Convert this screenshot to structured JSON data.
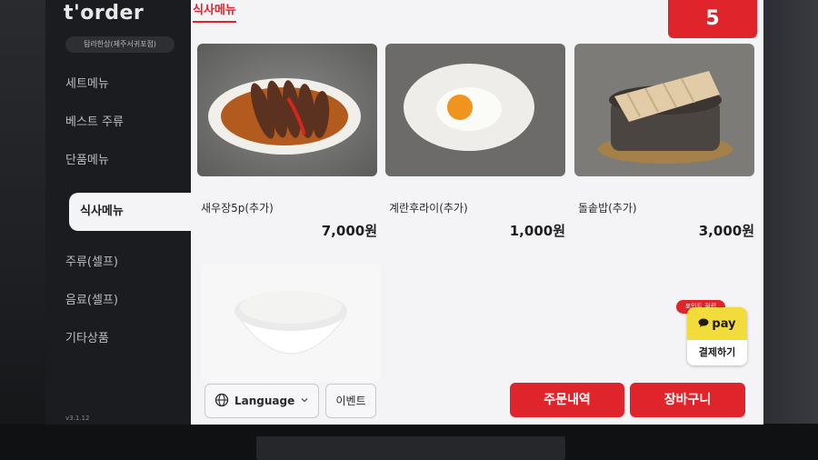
{
  "sidebar": {
    "logo": "t'order",
    "store": "탐라한상(제주서귀포점)",
    "items": [
      {
        "label": "세트메뉴"
      },
      {
        "label": "베스트 주류"
      },
      {
        "label": "단품메뉴"
      },
      {
        "label": "식사메뉴"
      },
      {
        "label": "주류(셀프)"
      },
      {
        "label": "음료(셀프)"
      },
      {
        "label": "기타상품"
      }
    ],
    "footer_code": "v3.1.12"
  },
  "header": {
    "active_tab": "식사메뉴",
    "table_number": "5"
  },
  "menu": {
    "items": [
      {
        "name": "새우장5p(추가)",
        "price": "7,000원",
        "image": "marinated-shrimp-photo"
      },
      {
        "name": "계란후라이(추가)",
        "price": "1,000원",
        "image": "fried-egg-photo"
      },
      {
        "name": "돌솥밥(추가)",
        "price": "3,000원",
        "image": "stone-pot-rice-photo"
      },
      {
        "name": "",
        "price": "",
        "image": "steamed-rice-bowl-photo"
      }
    ]
  },
  "controls": {
    "language_label": "Language",
    "event_label": "이벤트",
    "order_history_label": "주문내역",
    "cart_label": "장바구니"
  },
  "kakao_pay": {
    "tag": "포인트 적립",
    "pay_label": "pay",
    "checkout_label": "결제하기"
  },
  "colors": {
    "accent": "#e0242c",
    "sidebar_bg": "#1b1c1f",
    "screen_bg": "#f4f4f6",
    "kakao_yellow": "#f2dc3c"
  }
}
